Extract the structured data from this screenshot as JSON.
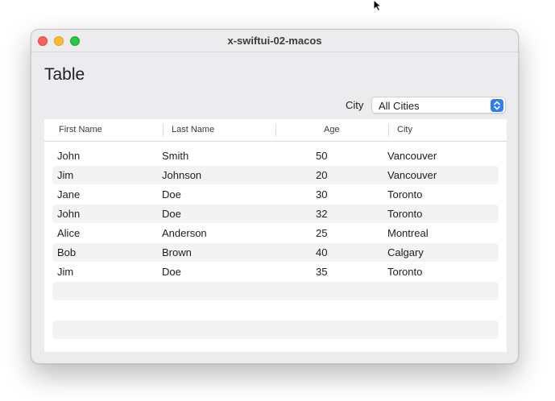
{
  "window": {
    "title": "x-swiftui-02-macos"
  },
  "page": {
    "heading": "Table"
  },
  "filter": {
    "label": "City",
    "selected": "All Cities"
  },
  "table": {
    "columns": [
      "First Name",
      "Last Name",
      "Age",
      "City"
    ],
    "rows": [
      {
        "first": "John",
        "last": "Smith",
        "age": "50",
        "city": "Vancouver"
      },
      {
        "first": "Jim",
        "last": "Johnson",
        "age": "20",
        "city": "Vancouver"
      },
      {
        "first": "Jane",
        "last": "Doe",
        "age": "30",
        "city": "Toronto"
      },
      {
        "first": "John",
        "last": "Doe",
        "age": "32",
        "city": "Toronto"
      },
      {
        "first": "Alice",
        "last": "Anderson",
        "age": "25",
        "city": "Montreal"
      },
      {
        "first": "Bob",
        "last": "Brown",
        "age": "40",
        "city": "Calgary"
      },
      {
        "first": "Jim",
        "last": "Doe",
        "age": "35",
        "city": "Toronto"
      }
    ]
  },
  "icons": {
    "cursor": "arrow-cursor-icon",
    "select": "up-down-chevron-icon"
  }
}
